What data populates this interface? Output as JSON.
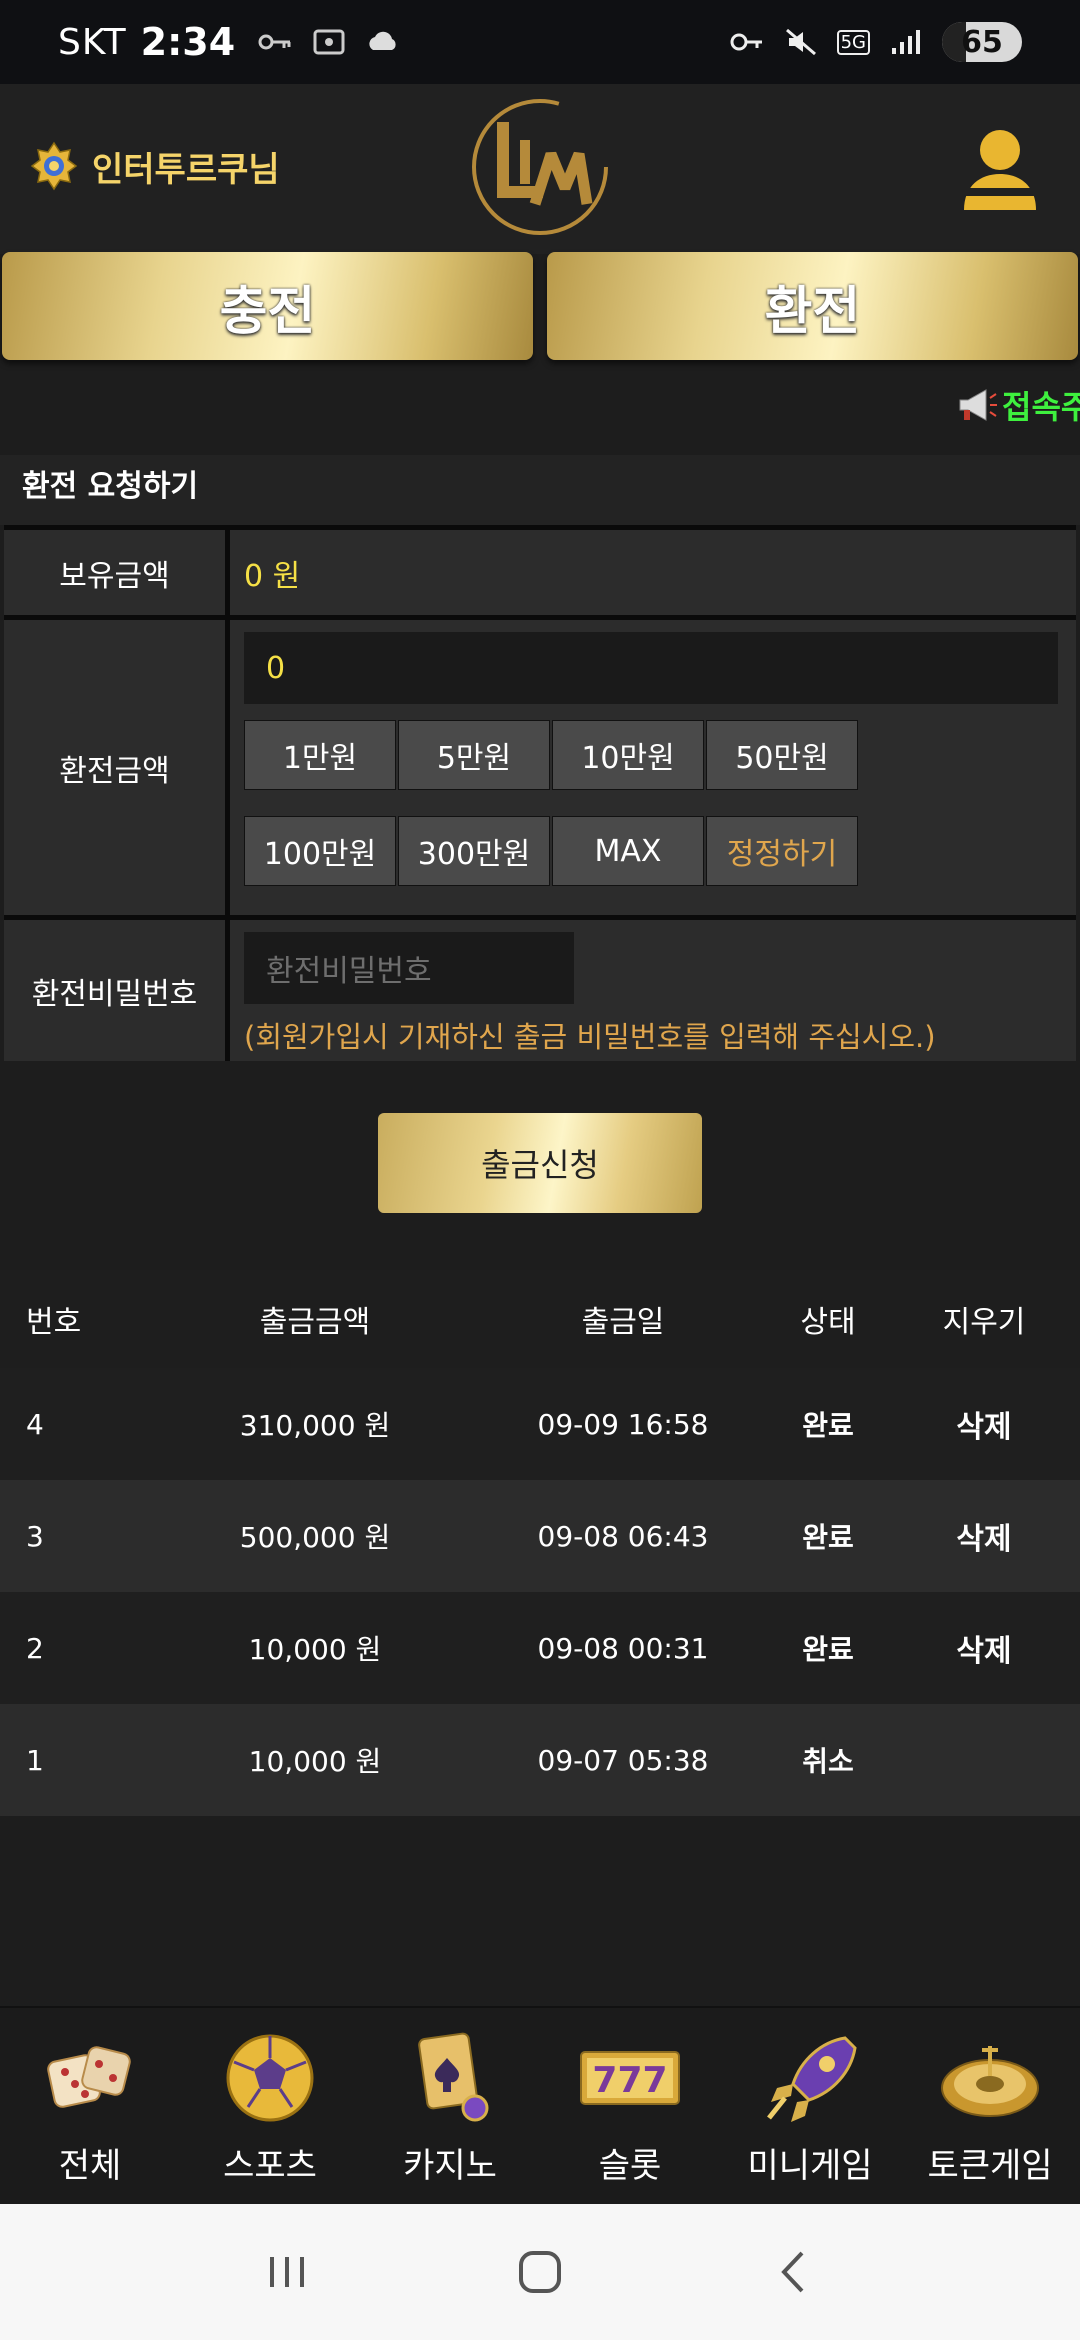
{
  "status": {
    "carrier": "SKT",
    "time": "2:34",
    "battery": "65",
    "network": "5G"
  },
  "header": {
    "username": "인터투르쿠님"
  },
  "top_buttons": {
    "deposit": "충전",
    "withdraw": "환전"
  },
  "notice": {
    "text": "접속주"
  },
  "form": {
    "title": "환전 요청하기",
    "balance_label": "보유금액",
    "balance_value": "0 원",
    "amount_label": "환전금액",
    "amount_value": "0",
    "amount_buttons": [
      "1만원",
      "5만원",
      "10만원",
      "50만원",
      "100만원",
      "300만원",
      "MAX",
      "정정하기"
    ],
    "password_label": "환전비밀번호",
    "password_placeholder": "환전비밀번호",
    "password_note": "(회원가입시 기재하신 출금 비밀번호를 입력해 주십시오.)",
    "submit": "출금신청"
  },
  "history": {
    "columns": [
      "번호",
      "출금금액",
      "출금일",
      "상태",
      "지우기"
    ],
    "rows": [
      {
        "no": "4",
        "amount": "310,000 원",
        "date": "09-09 16:58",
        "status": "완료",
        "action": "삭제"
      },
      {
        "no": "3",
        "amount": "500,000 원",
        "date": "09-08 06:43",
        "status": "완료",
        "action": "삭제"
      },
      {
        "no": "2",
        "amount": "10,000 원",
        "date": "09-08 00:31",
        "status": "완료",
        "action": "삭제"
      },
      {
        "no": "1",
        "amount": "10,000 원",
        "date": "09-07 05:38",
        "status": "취소",
        "action": ""
      }
    ]
  },
  "bottom_nav": [
    {
      "label": "전체",
      "icon": "dice-icon"
    },
    {
      "label": "스포츠",
      "icon": "soccer-ball-icon"
    },
    {
      "label": "카지노",
      "icon": "playing-cards-icon"
    },
    {
      "label": "슬롯",
      "icon": "slot-777-icon"
    },
    {
      "label": "미니게임",
      "icon": "rocket-icon"
    },
    {
      "label": "토큰게임",
      "icon": "roulette-icon"
    }
  ],
  "colors": {
    "gold": "#f5d46a",
    "yellow_value": "#f5e046",
    "orange_note": "#e0a64d",
    "notice_green": "#3ef03e"
  }
}
